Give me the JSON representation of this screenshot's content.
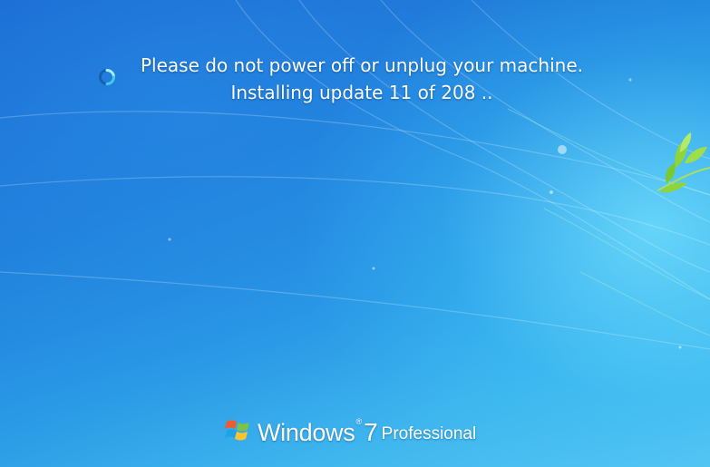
{
  "screen": {
    "message_line1": "Please do not power off or unplug your machine.",
    "message_line2": "Installing update 11 of 208  ..",
    "spinner_icon": "busy-spinner-icon"
  },
  "branding": {
    "logo_icon": "windows-flag-logo",
    "product_word": "Windows",
    "registered_mark": "®",
    "version": "7",
    "edition": "Professional"
  },
  "colors": {
    "background_deep": "#1a64cf",
    "background_light": "#56c6f2",
    "text": "#ffffff",
    "leaf_green": "#8fd43a"
  }
}
